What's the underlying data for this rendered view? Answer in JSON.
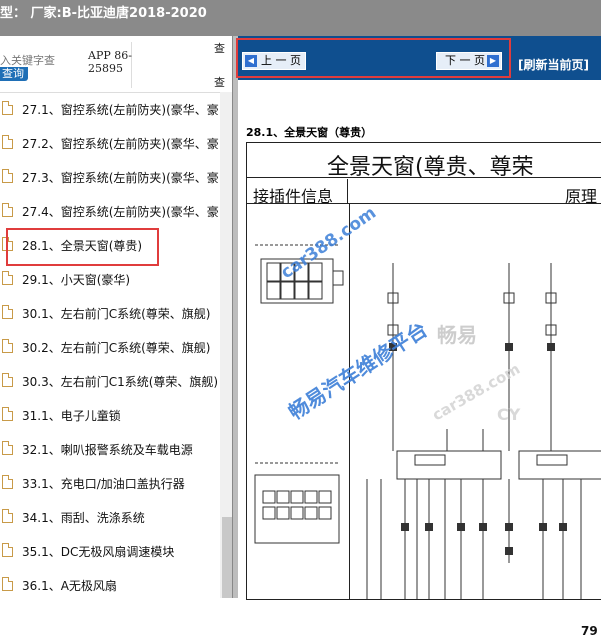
{
  "header": {
    "title": "型：  厂家:B-比亚迪唐2018-2020"
  },
  "search": {
    "keyword_placeholder": "入关键字查",
    "query_button": "查询",
    "app_line1": "APP 86-",
    "app_line2": "25895",
    "col_marker": "查"
  },
  "tree": {
    "items": [
      {
        "label": "27.1、窗控系统(左前防夹)(豪华、豪"
      },
      {
        "label": "27.2、窗控系统(左前防夹)(豪华、豪"
      },
      {
        "label": "27.3、窗控系统(左前防夹)(豪华、豪"
      },
      {
        "label": "27.4、窗控系统(左前防夹)(豪华、豪"
      },
      {
        "label": "28.1、全景天窗(尊贵)"
      },
      {
        "label": "29.1、小天窗(豪华)"
      },
      {
        "label": "30.1、左右前门C系统(尊荣、旗舰)"
      },
      {
        "label": "30.2、左右前门C系统(尊荣、旗舰)"
      },
      {
        "label": "30.3、左右前门C1系统(尊荣、旗舰)"
      },
      {
        "label": "31.1、电子儿童锁"
      },
      {
        "label": "32.1、喇叭报警系统及车载电源"
      },
      {
        "label": "33.1、充电口/加油口盖执行器"
      },
      {
        "label": "34.1、雨刮、洗涤系统"
      },
      {
        "label": "35.1、DC无极风扇调速模块"
      },
      {
        "label": "36.1、A无极风扇"
      }
    ],
    "selected_index": 4
  },
  "nav": {
    "prev_label": "上 一 页",
    "next_label": "下 一 页",
    "refresh_label": "[刷新当前页]"
  },
  "document": {
    "section_title": "28.1、全景天窗（尊贵）",
    "big_title": "全景天窗(尊贵、尊荣",
    "sub_left": "接插件信息",
    "sub_right": "原理",
    "page_number": "79",
    "watermarks": {
      "w1": "car388.com",
      "w2": "畅易汽车维修平台",
      "w3": "畅易",
      "w4": "car388.com",
      "w5": "CY"
    }
  },
  "colors": {
    "nav_blue": "#0f4f8f",
    "highlight_red": "#e03c3c",
    "watermark_blue": "#3d7fd8"
  }
}
